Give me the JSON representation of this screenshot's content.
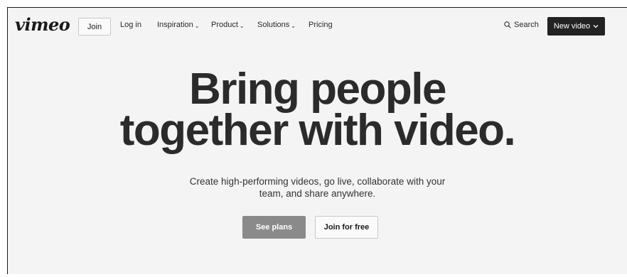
{
  "nav": {
    "logo": "vimeo",
    "join_label": "Join",
    "login_label": "Log in",
    "menu": [
      {
        "label": "Inspiration",
        "has_dropdown": true
      },
      {
        "label": "Product",
        "has_dropdown": true
      },
      {
        "label": "Solutions",
        "has_dropdown": true
      },
      {
        "label": "Pricing",
        "has_dropdown": false
      }
    ],
    "search_label": "Search",
    "new_video_label": "New video"
  },
  "hero": {
    "headline_line1": "Bring people",
    "headline_line2": "together with video.",
    "subtext_line1": "Create high-performing videos, go live, collaborate with your",
    "subtext_line2": "team, and share anywhere.",
    "primary_cta": "See plans",
    "secondary_cta": "Join for free"
  },
  "colors": {
    "background": "#f4f4f4",
    "primary_button": "#8a8a8a",
    "dark_button": "#222222",
    "text": "#2b2b2b"
  }
}
